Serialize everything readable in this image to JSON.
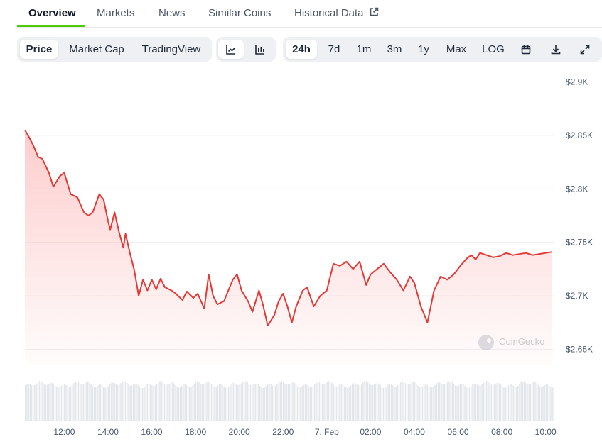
{
  "tabs": [
    {
      "label": "Overview"
    },
    {
      "label": "Markets"
    },
    {
      "label": "News"
    },
    {
      "label": "Similar Coins"
    },
    {
      "label": "Historical Data"
    }
  ],
  "toolbar": {
    "chart_modes": [
      {
        "label": "Price"
      },
      {
        "label": "Market Cap"
      },
      {
        "label": "TradingView"
      }
    ],
    "ranges": [
      {
        "label": "24h"
      },
      {
        "label": "7d"
      },
      {
        "label": "1m"
      },
      {
        "label": "3m"
      },
      {
        "label": "1y"
      },
      {
        "label": "Max"
      },
      {
        "label": "LOG"
      }
    ]
  },
  "watermark": "CoinGecko",
  "colors": {
    "line": "#e53935",
    "fill": "#fdd2d2",
    "active_tab": "#4bcc00",
    "volume": "#e2e5e9"
  },
  "chart_data": {
    "type": "line",
    "y_tick_labels": [
      "$2.65K",
      "$2.7K",
      "$2.75K",
      "$2.8K",
      "$2.85K",
      "$2.9K"
    ],
    "y_ticks": [
      2650,
      2700,
      2750,
      2800,
      2850,
      2900
    ],
    "ylim": [
      2635,
      2905
    ],
    "x_tick_labels": [
      "12:00",
      "14:00",
      "16:00",
      "18:00",
      "20:00",
      "22:00",
      "7. Feb",
      "02:00",
      "04:00",
      "06:00",
      "08:00",
      "10:00"
    ],
    "x_ticks": [
      12,
      14,
      16,
      18,
      20,
      22,
      24,
      26,
      28,
      30,
      32,
      34
    ],
    "xlim": [
      10.2,
      34.4
    ],
    "series": [
      {
        "x": [
          10.2,
          10.4,
          10.6,
          10.8,
          11.0,
          11.3,
          11.5,
          11.8,
          12.0,
          12.1,
          12.3,
          12.6,
          12.9,
          13.1,
          13.3,
          13.6,
          13.8,
          14.0,
          14.1,
          14.3,
          14.5,
          14.7,
          14.8,
          15.0,
          15.2,
          15.4,
          15.6,
          15.8,
          16.0,
          16.2,
          16.4,
          16.6,
          16.9,
          17.1,
          17.4,
          17.6,
          17.9,
          18.1,
          18.4,
          18.6,
          18.8,
          19.0,
          19.3,
          19.5,
          19.7,
          19.9,
          20.1,
          20.4,
          20.6,
          20.9,
          21.1,
          21.3,
          21.6,
          21.8,
          22.0,
          22.2,
          22.4,
          22.6,
          22.9,
          23.1,
          23.4,
          23.7,
          24.0,
          24.3,
          24.6,
          24.9,
          25.2,
          25.5,
          25.8,
          26.0,
          26.3,
          26.6,
          26.9,
          27.2,
          27.5,
          27.8,
          28.0,
          28.3,
          28.6,
          28.9,
          29.2,
          29.5,
          29.8,
          30.1,
          30.4,
          30.6,
          30.8,
          31.0,
          31.3,
          31.6,
          31.9,
          32.2,
          32.5,
          32.8,
          33.1,
          33.4,
          33.7,
          34.0,
          34.3
        ],
        "values": [
          2855,
          2848,
          2840,
          2830,
          2828,
          2815,
          2802,
          2812,
          2815,
          2808,
          2795,
          2792,
          2778,
          2775,
          2778,
          2795,
          2790,
          2770,
          2762,
          2778,
          2760,
          2745,
          2758,
          2740,
          2724,
          2700,
          2715,
          2705,
          2715,
          2706,
          2716,
          2708,
          2705,
          2702,
          2696,
          2704,
          2698,
          2702,
          2688,
          2720,
          2700,
          2692,
          2695,
          2705,
          2715,
          2720,
          2705,
          2695,
          2685,
          2705,
          2690,
          2672,
          2682,
          2695,
          2702,
          2690,
          2675,
          2690,
          2705,
          2708,
          2690,
          2700,
          2705,
          2730,
          2728,
          2732,
          2725,
          2732,
          2710,
          2720,
          2725,
          2730,
          2722,
          2715,
          2705,
          2718,
          2712,
          2690,
          2675,
          2705,
          2718,
          2715,
          2720,
          2728,
          2735,
          2738,
          2734,
          2740,
          2738,
          2736,
          2737,
          2740,
          2738,
          2739,
          2740,
          2738,
          2739,
          2740,
          2741
        ]
      }
    ],
    "grid": true
  }
}
